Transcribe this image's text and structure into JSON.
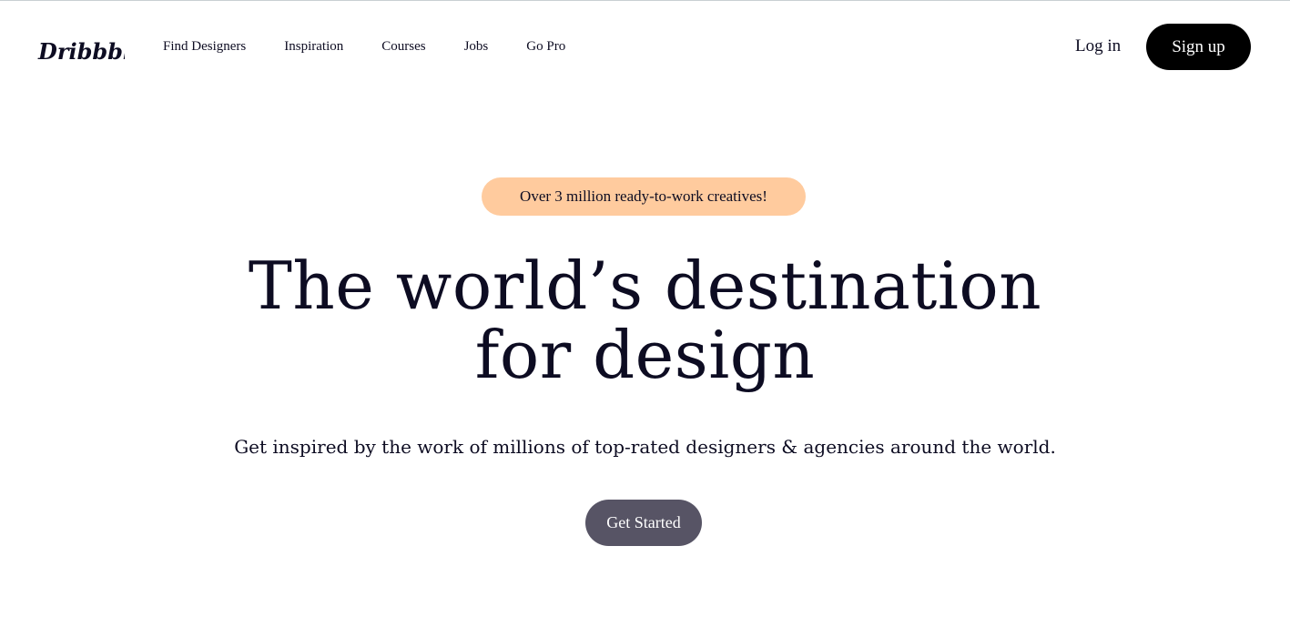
{
  "header": {
    "logo_text": "Dribbble",
    "nav": [
      {
        "label": "Find Designers"
      },
      {
        "label": "Inspiration"
      },
      {
        "label": "Courses"
      },
      {
        "label": "Jobs"
      },
      {
        "label": "Go Pro"
      }
    ],
    "login_label": "Log in",
    "signup_label": "Sign up"
  },
  "hero": {
    "badge": "Over 3 million ready-to-work creatives!",
    "title_line1": "The world’s destination",
    "title_line2": "for design",
    "subtitle": "Get inspired by the work of millions of top-rated designers & agencies around the world.",
    "cta_label": "Get Started"
  },
  "colors": {
    "badge_bg": "#ffcb9e",
    "signup_bg": "#000000",
    "cta_bg": "#575465",
    "text": "#0d0c22"
  }
}
